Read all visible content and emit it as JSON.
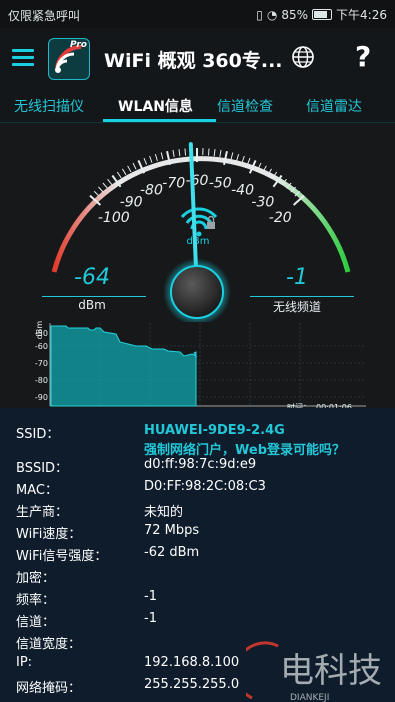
{
  "status": {
    "left_text": "仅限紧急呼叫",
    "battery": "85%",
    "time": "下午4:26"
  },
  "app": {
    "title": "WiFi 概观 360专...",
    "pro_badge": "Pro"
  },
  "tabs": [
    {
      "label": "无线扫描仪"
    },
    {
      "label": "WLAN信息"
    },
    {
      "label": "信道检查"
    },
    {
      "label": "信道雷达"
    }
  ],
  "gauge": {
    "ticks": [
      "-100",
      "-90",
      "-80",
      "-70",
      "-60",
      "-50",
      "-40",
      "-30",
      "-20"
    ],
    "center_unit": "dBm",
    "signal_value": "-64",
    "signal_unit": "dBm",
    "channel_value": "-1",
    "channel_label": "无线频道",
    "needle_value": -62
  },
  "graph": {
    "ylabel": "dBm",
    "yticks": [
      "-50",
      "-60",
      "-70",
      "-80",
      "-90"
    ],
    "time_label": "时间：",
    "time_value": "00:01:06"
  },
  "details": {
    "ssid_label": "SSID：",
    "ssid_value": "HUAWEI-9DE9-2.4G",
    "portal_note": "强制网络门户，Web登录可能吗？",
    "bssid_label": "BSSID：",
    "bssid_value": "d0:ff:98:7c:9d:e9",
    "mac_label": "MAC：",
    "mac_value": "D0:FF:98:2C:08:C3",
    "vendor_label": "生产商：",
    "vendor_value": "未知的",
    "speed_label": "WiFi速度：",
    "speed_value": "72 Mbps",
    "strength_label": "WiFi信号强度：",
    "strength_value": "-62 dBm",
    "encryption_label": "加密：",
    "frequency_label": "频率：",
    "frequency_value": "-1",
    "channel_label": "信道：",
    "channel_value": "-1",
    "width_label": "信道宽度：",
    "ip_label": "IP:",
    "ip_value": "192.168.8.100",
    "mask_label": "网络掩码：",
    "mask_value": "255.255.255.0"
  },
  "watermark": {
    "text": "电科技",
    "sub": "DIANKEJI"
  },
  "colors": {
    "accent": "#19d0e0",
    "panel": "#0f1c2c",
    "background": "#16181a"
  }
}
